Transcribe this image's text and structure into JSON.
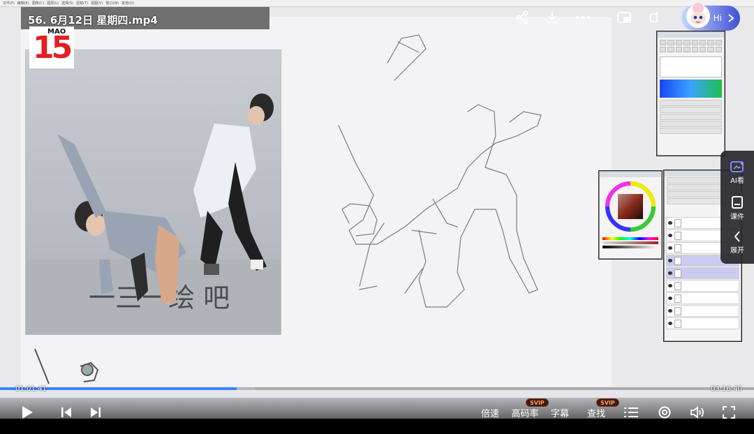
{
  "header": {
    "title": "56. 6月12日 星期四.mp4",
    "assistant_label": "Hi"
  },
  "logo": {
    "number": "15",
    "word": "MAO",
    "color": "#e31e24"
  },
  "icons": {
    "share": "share-icon",
    "download": "download-icon",
    "more": "more-icon",
    "pip": "picture-in-picture-icon",
    "mini": "mini-window-icon"
  },
  "side_panel": {
    "items": [
      {
        "label": "AI看",
        "icon": "ai-view-icon"
      },
      {
        "label": "课件",
        "icon": "courseware-icon"
      },
      {
        "label": "展开",
        "icon": "chevron-left-icon"
      }
    ]
  },
  "player": {
    "current_time": "01:01:41",
    "total_time": "03:16:40",
    "progress": 0.3135,
    "buffered": 0.338,
    "speed_label": "倍速",
    "quality_label": "高码率",
    "quality_badge": "SVIP",
    "subtitle_label": "字幕",
    "search_label": "查找",
    "search_badge": "SVIP",
    "accent": "#3b82f6"
  }
}
